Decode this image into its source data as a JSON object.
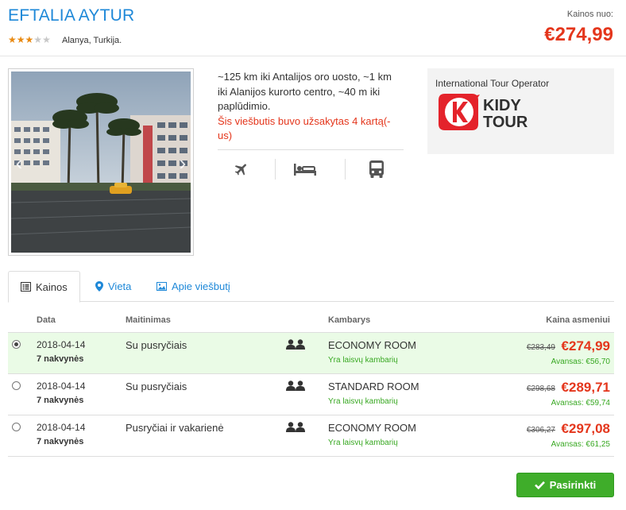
{
  "hotel": {
    "name": "EFTALIA AYTUR",
    "stars_filled": 3,
    "stars_total": 5,
    "location": "Alanya, Turkija.",
    "price_from_label": "Kainos nuo:",
    "price_from": "€274,99"
  },
  "description": {
    "text": "~125 km iki Antalijos oro uosto, ~1 km iki Alanijos kurorto centro, ~40 m iki paplūdimio.",
    "booked_note": "Šis viešbutis buvo užsakytas 4 kartą(-us)"
  },
  "amenities": [
    "plane-icon",
    "bed-icon",
    "bus-icon"
  ],
  "operator": {
    "label": "International Tour Operator",
    "logo_text_line1": "KIDY",
    "logo_text_line2": "TOUR",
    "logo_letter": "K"
  },
  "tabs": [
    {
      "label": "Kainos",
      "icon": "list-icon",
      "active": true
    },
    {
      "label": "Vieta",
      "icon": "map-marker-icon",
      "active": false
    },
    {
      "label": "Apie viešbutį",
      "icon": "picture-icon",
      "active": false
    }
  ],
  "table": {
    "headers": {
      "date": "Data",
      "meal": "Maitinimas",
      "room": "Kambarys",
      "price": "Kaina asmeniui"
    },
    "rows": [
      {
        "date": "2018-04-14",
        "nights": "7 nakvynės",
        "meal": "Su pusryčiais",
        "room": "ECONOMY ROOM",
        "availability": "Yra laisvų kambarių",
        "old_price": "€283,49",
        "price": "€274,99",
        "deposit": "Avansas: €56,70",
        "selected": true
      },
      {
        "date": "2018-04-14",
        "nights": "7 nakvynės",
        "meal": "Su pusryčiais",
        "room": "STANDARD ROOM",
        "availability": "Yra laisvų kambarių",
        "old_price": "€298,68",
        "price": "€289,71",
        "deposit": "Avansas: €59,74",
        "selected": false
      },
      {
        "date": "2018-04-14",
        "nights": "7 nakvynės",
        "meal": "Pusryčiai ir vakarienė",
        "room": "ECONOMY ROOM",
        "availability": "Yra laisvų kambarių",
        "old_price": "€306,27",
        "price": "€297,08",
        "deposit": "Avansas: €61,25",
        "selected": false
      }
    ]
  },
  "actions": {
    "select_label": "Pasirinkti"
  },
  "colors": {
    "accent_blue": "#1e88d8",
    "price_red": "#e4361c",
    "green": "#3fad2a",
    "star": "#e98a12"
  }
}
